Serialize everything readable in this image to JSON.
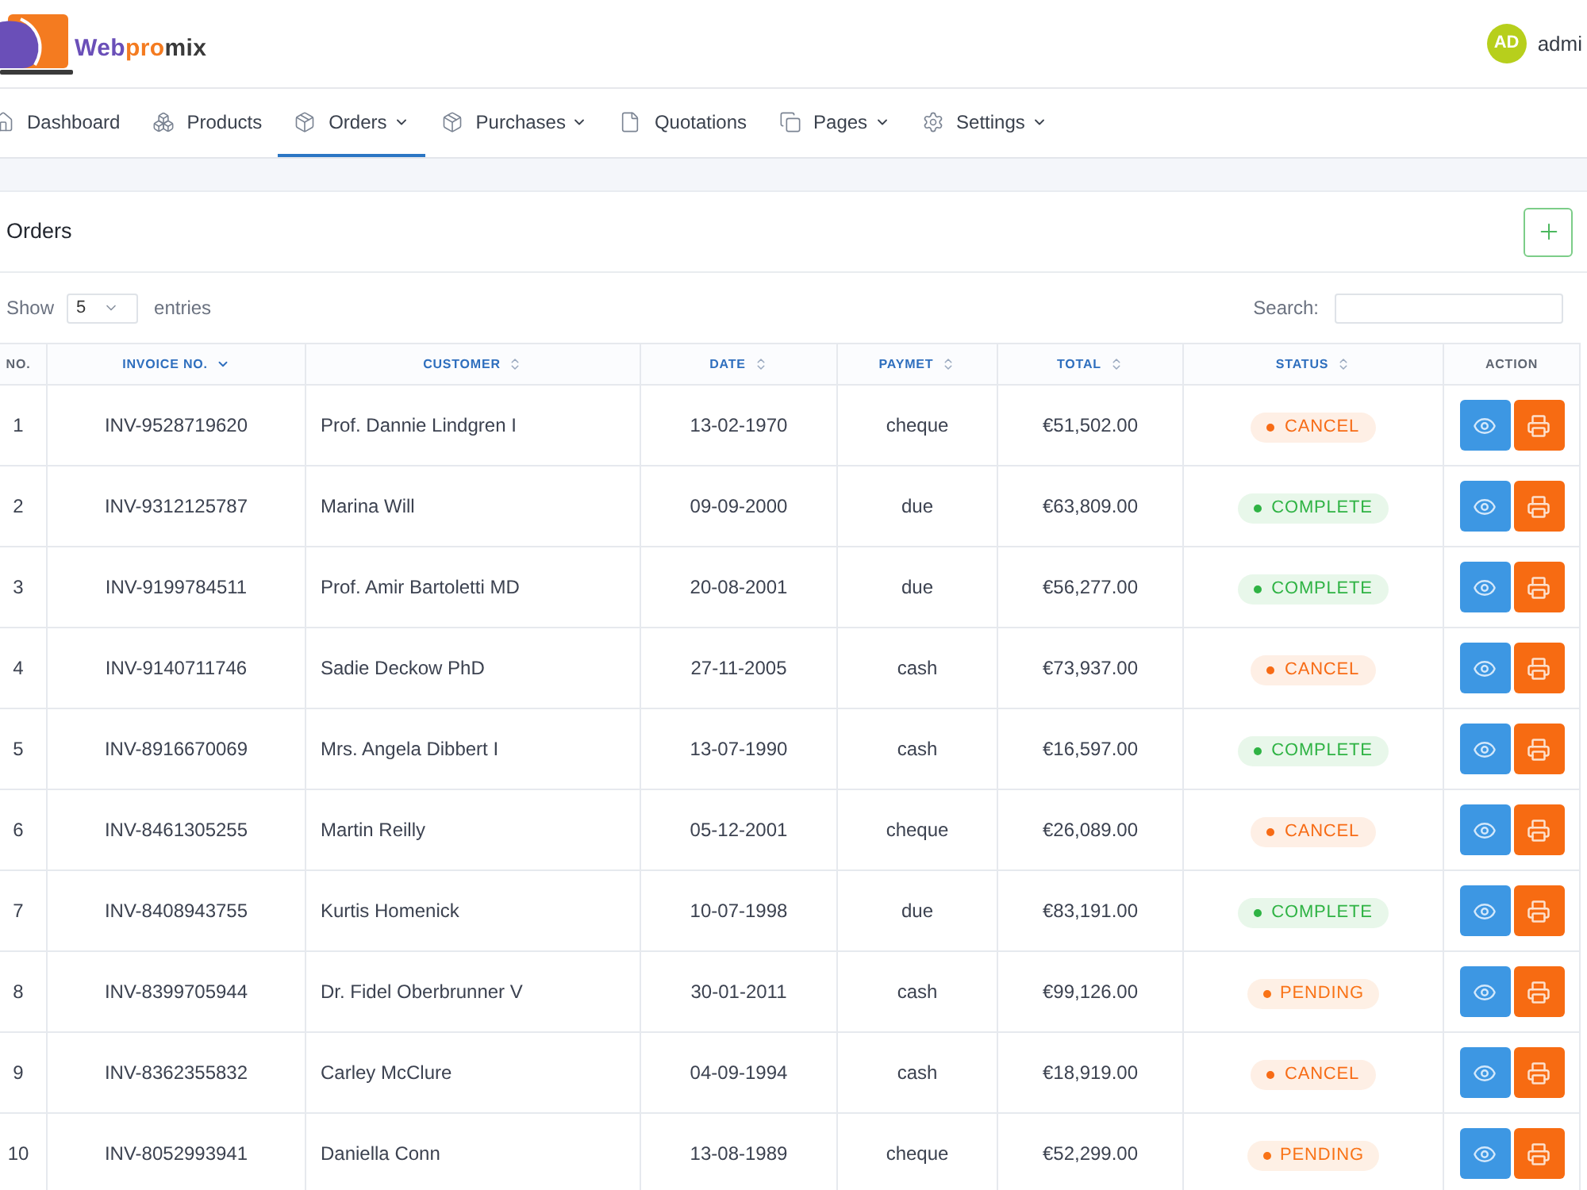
{
  "header": {
    "brand": {
      "parts": [
        {
          "text": "Web",
          "color": "#6a4fb8"
        },
        {
          "text": "pro",
          "color": "#f47b20"
        },
        {
          "text": "mix",
          "color": "#3a3a3a"
        }
      ]
    },
    "user": {
      "initials": "AD",
      "name": "admi"
    }
  },
  "nav": [
    {
      "label": "Dashboard",
      "selected": false,
      "dropdown": false
    },
    {
      "label": "Products",
      "selected": false,
      "dropdown": false
    },
    {
      "label": "Orders",
      "selected": true,
      "dropdown": true
    },
    {
      "label": "Purchases",
      "selected": false,
      "dropdown": true
    },
    {
      "label": "Quotations",
      "selected": false,
      "dropdown": false
    },
    {
      "label": "Pages",
      "selected": false,
      "dropdown": true
    },
    {
      "label": "Settings",
      "selected": false,
      "dropdown": true
    }
  ],
  "card": {
    "title": "Orders",
    "length": {
      "label_before": "Show",
      "value": "5",
      "label_after": "entries"
    },
    "search": {
      "label": "Search:"
    }
  },
  "table": {
    "columns": [
      {
        "label": "NO.",
        "kind": "plain"
      },
      {
        "label": "INVOICE NO.",
        "kind": "sorted"
      },
      {
        "label": "CUSTOMER",
        "kind": "sortable"
      },
      {
        "label": "DATE",
        "kind": "sortable"
      },
      {
        "label": "PAYMET",
        "kind": "sortable"
      },
      {
        "label": "TOTAL",
        "kind": "sortable"
      },
      {
        "label": "STATUS",
        "kind": "sortable"
      },
      {
        "label": "ACTION",
        "kind": "plain"
      }
    ],
    "rows": [
      {
        "no": "1",
        "invoice": "INV-9528719620",
        "customer": "Prof. Dannie Lindgren I",
        "date": "13-02-1970",
        "payment": "cheque",
        "total": "€51,502.00",
        "status": {
          "text": "CANCEL",
          "color": "#f76b15"
        }
      },
      {
        "no": "2",
        "invoice": "INV-9312125787",
        "customer": "Marina Will",
        "date": "09-09-2000",
        "payment": "due",
        "total": "€63,809.00",
        "status": {
          "text": "COMPLETE",
          "color": "#2fb344"
        }
      },
      {
        "no": "3",
        "invoice": "INV-9199784511",
        "customer": "Prof. Amir Bartoletti MD",
        "date": "20-08-2001",
        "payment": "due",
        "total": "€56,277.00",
        "status": {
          "text": "COMPLETE",
          "color": "#2fb344"
        }
      },
      {
        "no": "4",
        "invoice": "INV-9140711746",
        "customer": "Sadie Deckow PhD",
        "date": "27-11-2005",
        "payment": "cash",
        "total": "€73,937.00",
        "status": {
          "text": "CANCEL",
          "color": "#f76b15"
        }
      },
      {
        "no": "5",
        "invoice": "INV-8916670069",
        "customer": "Mrs. Angela Dibbert I",
        "date": "13-07-1990",
        "payment": "cash",
        "total": "€16,597.00",
        "status": {
          "text": "COMPLETE",
          "color": "#2fb344"
        }
      },
      {
        "no": "6",
        "invoice": "INV-8461305255",
        "customer": "Martin Reilly",
        "date": "05-12-2001",
        "payment": "cheque",
        "total": "€26,089.00",
        "status": {
          "text": "CANCEL",
          "color": "#f76b15"
        }
      },
      {
        "no": "7",
        "invoice": "INV-8408943755",
        "customer": "Kurtis Homenick",
        "date": "10-07-1998",
        "payment": "due",
        "total": "€83,191.00",
        "status": {
          "text": "COMPLETE",
          "color": "#2fb344"
        }
      },
      {
        "no": "8",
        "invoice": "INV-8399705944",
        "customer": "Dr. Fidel Oberbrunner V",
        "date": "30-01-2011",
        "payment": "cash",
        "total": "€99,126.00",
        "status": {
          "text": "PENDING",
          "color": "#f97316"
        }
      },
      {
        "no": "9",
        "invoice": "INV-8362355832",
        "customer": "Carley McClure",
        "date": "04-09-1994",
        "payment": "cash",
        "total": "€18,919.00",
        "status": {
          "text": "CANCEL",
          "color": "#f76b15"
        }
      },
      {
        "no": "10",
        "invoice": "INV-8052993941",
        "customer": "Daniella Conn",
        "date": "13-08-1989",
        "payment": "cheque",
        "total": "€52,299.00",
        "status": {
          "text": "PENDING",
          "color": "#f97316"
        }
      }
    ]
  }
}
